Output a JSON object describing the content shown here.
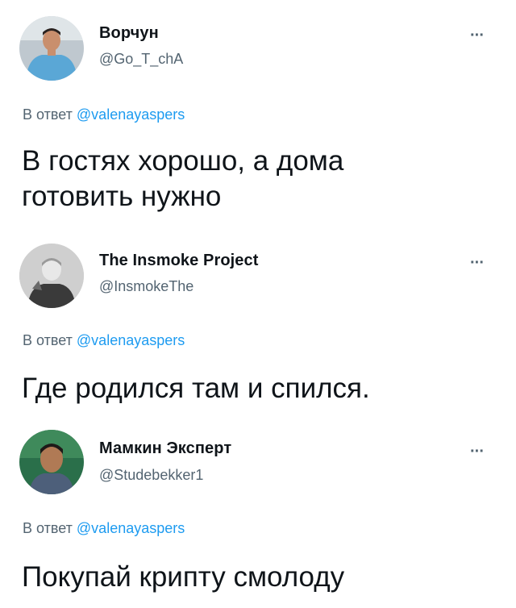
{
  "tweets": [
    {
      "name": "Ворчун",
      "handle": "@Go_T_chA",
      "reply_prefix": "В ответ",
      "reply_to": "@valenayaspers",
      "text_lines": [
        "В гостях хорошо, а дома",
        "готовить нужно"
      ]
    },
    {
      "name": "The Insmoke Project",
      "handle": "@InsmokeThe",
      "reply_prefix": "В ответ",
      "reply_to": "@valenayaspers",
      "text_lines": [
        "Где родился там и спился."
      ]
    },
    {
      "name": "Мамкин Эксперт",
      "handle": "@Studebekker1",
      "reply_prefix": "В ответ",
      "reply_to": "@valenayaspers",
      "text_lines": [
        "Покупай крипту смолоду"
      ]
    }
  ],
  "more_icon": "···",
  "colors": {
    "text": "#0f1419",
    "secondary": "#536471",
    "link": "#1d9bf0",
    "background": "#ffffff"
  }
}
